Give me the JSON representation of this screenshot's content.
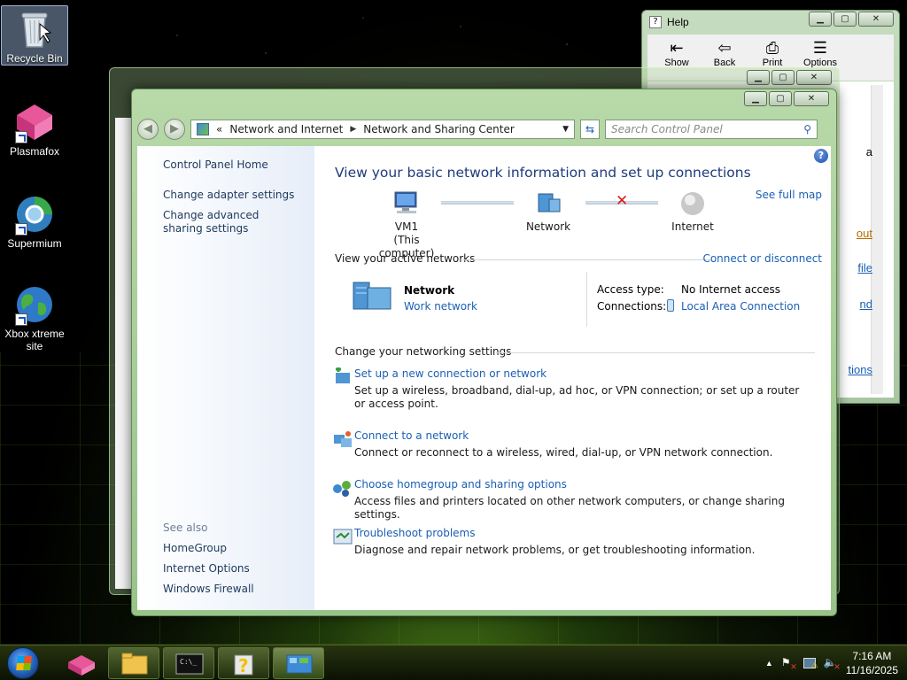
{
  "desktop": {
    "icons": [
      {
        "label": "Recycle Bin"
      },
      {
        "label": "Plasmafox"
      },
      {
        "label": "Supermium"
      },
      {
        "label": "Xbox xtreme site"
      }
    ]
  },
  "help_window": {
    "title": "Help",
    "tools": [
      "Show",
      "Back",
      "Print",
      "Options"
    ],
    "partial_links": [
      "a",
      "out",
      "file",
      "nd",
      "tions"
    ]
  },
  "window": {
    "address": {
      "prefix": "«",
      "crumbs": [
        "Network and Internet",
        "Network and Sharing Center"
      ]
    },
    "search_placeholder": "Search Control Panel"
  },
  "sidebar": {
    "home": "Control Panel Home",
    "links": [
      "Change adapter settings",
      "Change advanced sharing settings"
    ],
    "see_also_label": "See also",
    "see_also": [
      "HomeGroup",
      "Internet Options",
      "Windows Firewall"
    ]
  },
  "main": {
    "heading": "View your basic network information and set up connections",
    "see_full_map": "See full map",
    "map": {
      "computer_name": "VM1",
      "computer_sub": "(This computer)",
      "network": "Network",
      "internet": "Internet"
    },
    "active_networks": {
      "title": "View your active networks",
      "connect_link": "Connect or disconnect",
      "network_name": "Network",
      "network_type": "Work network",
      "access_type_label": "Access type:",
      "access_type_value": "No Internet access",
      "connections_label": "Connections:",
      "connections_value": "Local Area Connection"
    },
    "settings": {
      "title": "Change your networking settings",
      "tasks": [
        {
          "title": "Set up a new connection or network",
          "desc": "Set up a wireless, broadband, dial-up, ad hoc, or VPN connection; or set up a router or access point."
        },
        {
          "title": "Connect to a network",
          "desc": "Connect or reconnect to a wireless, wired, dial-up, or VPN network connection."
        },
        {
          "title": "Choose homegroup and sharing options",
          "desc": "Access files and printers located on other network computers, or change sharing settings."
        },
        {
          "title": "Troubleshoot problems",
          "desc": "Diagnose and repair network problems, or get troubleshooting information."
        }
      ]
    }
  },
  "taskbar": {
    "time": "7:16 AM",
    "date": "11/16/2025"
  }
}
